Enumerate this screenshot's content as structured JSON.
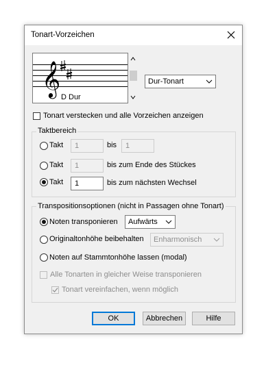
{
  "dialog": {
    "title": "Tonart-Vorzeichen",
    "close_icon": "close-icon"
  },
  "preview": {
    "key_name": "D Dur",
    "clef_icon": "treble-clef-icon",
    "sharps": 2
  },
  "mode_select": {
    "value": "Dur-Tonart"
  },
  "hide_key": {
    "label": "Tonart verstecken und alle Vorzeichen anzeigen",
    "checked": false
  },
  "measure_range": {
    "legend": "Taktbereich",
    "row1": {
      "label": "Takt",
      "value": "1",
      "bis": "bis",
      "to_value": "1",
      "selected": false
    },
    "row2": {
      "label": "Takt",
      "value": "1",
      "suffix": "bis zum Ende des Stückes",
      "selected": false
    },
    "row3": {
      "label": "Takt",
      "value": "1",
      "suffix": "bis zum nächsten Wechsel",
      "selected": true
    }
  },
  "transposition": {
    "legend": "Transpositionsoptionen (nicht in Passagen ohne Tonart)",
    "opt_transpose": {
      "label": "Noten transponieren",
      "selected": true
    },
    "direction_select": {
      "value": "Aufwärts"
    },
    "opt_keep_pitch": {
      "label": "Originaltonhöhe beibehalten",
      "selected": false
    },
    "enharmonic_select": {
      "value": "Enharmonisch"
    },
    "opt_modal": {
      "label": "Noten auf Stammtonhöhe lassen (modal)",
      "selected": false
    },
    "all_keys": {
      "label": "Alle Tonarten in gleicher Weise transponieren",
      "checked": false
    },
    "simplify": {
      "label": "Tonart vereinfachen, wenn möglich",
      "checked": true
    }
  },
  "buttons": {
    "ok": "OK",
    "cancel": "Abbrechen",
    "help": "Hilfe"
  }
}
